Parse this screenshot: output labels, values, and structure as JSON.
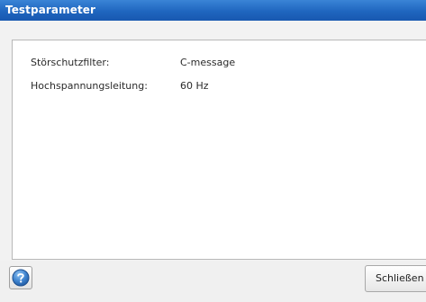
{
  "dialog": {
    "title": "Testparameter"
  },
  "parameters": [
    {
      "label": "Störschutzfilter:",
      "value": "C-message"
    },
    {
      "label": "Hochspannungsleitung:",
      "value": "60 Hz"
    }
  ],
  "footer": {
    "help_icon": "question-mark-icon",
    "close_label": "Schließen"
  },
  "colors": {
    "titlebar": "#1f66bf",
    "help_icon": "#2f6fbf"
  }
}
